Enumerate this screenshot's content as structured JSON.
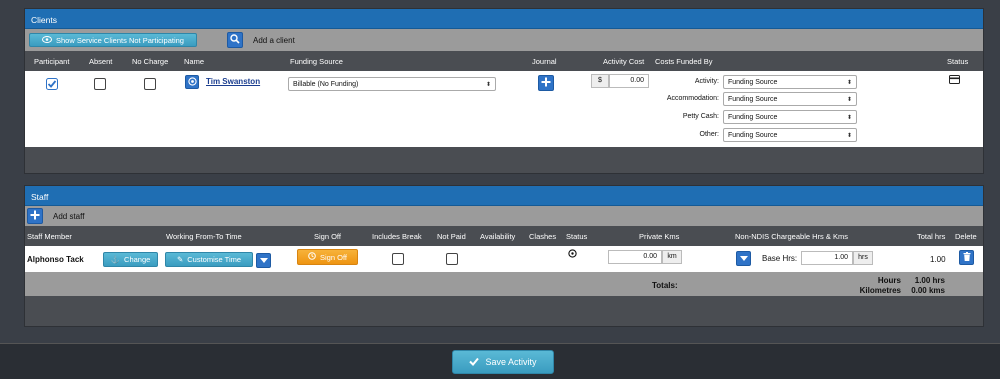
{
  "clients": {
    "title": "Clients",
    "show_not_participating_label": "Show Service Clients Not Participating",
    "add_client_label": "Add a client",
    "columns": {
      "participant": "Participant",
      "absent": "Absent",
      "no_charge": "No Charge",
      "name": "Name",
      "funding_source": "Funding Source",
      "journal": "Journal",
      "activity_cost": "Activity Cost",
      "costs_funded_by": "Costs Funded By",
      "status": "Status"
    },
    "row": {
      "participant_checked": true,
      "absent_checked": false,
      "no_charge_checked": false,
      "name": "Tim Swanston",
      "funding_source_value": "Billable (No Funding)",
      "currency_symbol": "$",
      "activity_cost": "0.00",
      "funded_by": [
        {
          "label": "Activity:",
          "value": "Funding Source"
        },
        {
          "label": "Accommodation:",
          "value": "Funding Source"
        },
        {
          "label": "Petty Cash:",
          "value": "Funding Source"
        },
        {
          "label": "Other:",
          "value": "Funding Source"
        }
      ]
    }
  },
  "staff": {
    "title": "Staff",
    "add_staff_label": "Add staff",
    "columns": {
      "staff_member": "Staff Member",
      "working_time": "Working From-To Time",
      "sign_off": "Sign Off",
      "includes_break": "Includes Break",
      "not_paid": "Not Paid",
      "availability": "Availability",
      "clashes": "Clashes",
      "status": "Status",
      "private_kms": "Private Kms",
      "ndis_chargeable": "Non-NDIS Chargeable Hrs & Kms",
      "total_hrs": "Total hrs",
      "delete": "Delete"
    },
    "row": {
      "name": "Alphonso Tack",
      "change_label": "Change",
      "customise_label": "Customise Time",
      "sign_off_label": "Sign Off",
      "includes_break_checked": false,
      "not_paid_checked": false,
      "private_kms_value": "0.00",
      "kms_unit": "km",
      "base_hrs_label": "Base Hrs:",
      "base_hrs_value": "1.00",
      "hrs_unit": "hrs",
      "total_hrs": "1.00"
    },
    "totals": {
      "label": "Totals:",
      "hours_label": "Hours",
      "hours_value": "1.00 hrs",
      "km_label": "Kilometres",
      "km_value": "0.00 kms"
    }
  },
  "footer": {
    "save_label": "Save Activity"
  },
  "colors": {
    "header_blue": "#1f6eb3",
    "teal_button": "#3a9cc0",
    "orange_button": "#f0a020",
    "background": "#3a3f47"
  }
}
